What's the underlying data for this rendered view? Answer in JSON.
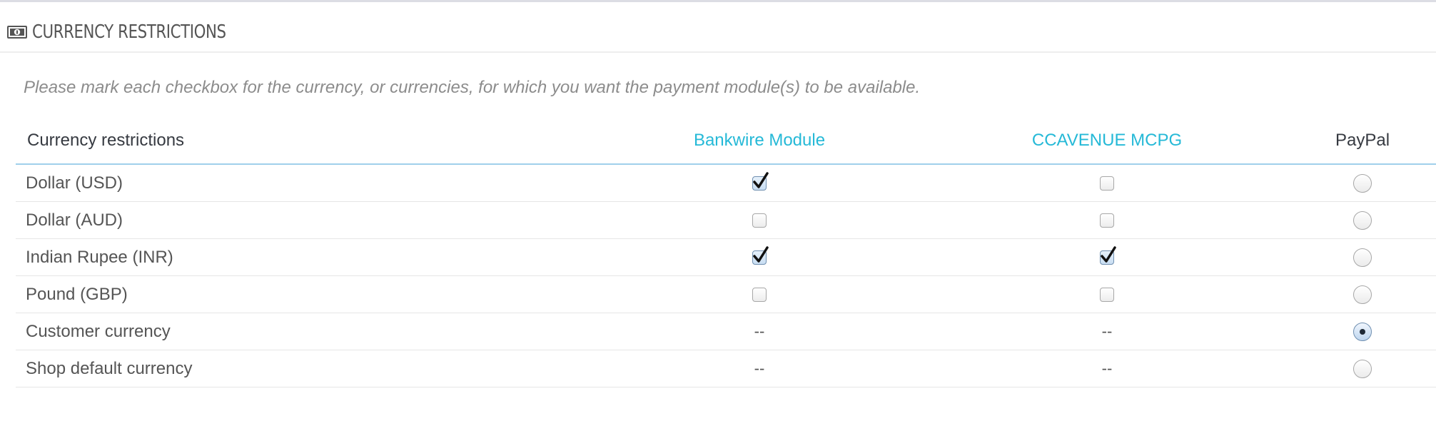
{
  "panel": {
    "title": "CURRENCY RESTRICTIONS",
    "help_text": "Please mark each checkbox for the currency, or currencies, for which you want the payment module(s) to be available."
  },
  "table": {
    "header_label": "Currency restrictions",
    "modules": [
      "Bankwire Module",
      "CCAVENUE MCPG",
      "PayPal"
    ],
    "rows": [
      {
        "label": "Dollar (USD)",
        "bankwire": true,
        "ccavenue": false,
        "paypal_selected": false
      },
      {
        "label": "Dollar (AUD)",
        "bankwire": false,
        "ccavenue": false,
        "paypal_selected": false
      },
      {
        "label": "Indian Rupee (INR)",
        "bankwire": true,
        "ccavenue": true,
        "paypal_selected": false
      },
      {
        "label": "Pound (GBP)",
        "bankwire": false,
        "ccavenue": false,
        "paypal_selected": false
      },
      {
        "label": "Customer currency",
        "bankwire_text": "--",
        "ccavenue_text": "--",
        "paypal_selected": true
      },
      {
        "label": "Shop default currency",
        "bankwire_text": "--",
        "ccavenue_text": "--",
        "paypal_selected": false
      }
    ]
  },
  "colors": {
    "link": "#25b9d7",
    "header_border": "#a0d0eb",
    "muted_text": "#8c8c8c"
  },
  "icons": {
    "heading": "money-icon",
    "checked": "checkmark-icon",
    "radio_selected": "radio-dot-icon"
  }
}
